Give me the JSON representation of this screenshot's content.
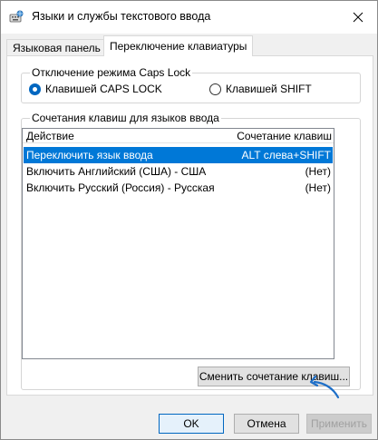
{
  "window": {
    "title": "Языки и службы текстового ввода",
    "icons": {
      "app": "keyboard-globe-icon",
      "close": "close-icon"
    }
  },
  "tabs": [
    {
      "label": "Языковая панель",
      "active": false
    },
    {
      "label": "Переключение клавиатуры",
      "active": true
    }
  ],
  "caps_lock": {
    "legend": "Отключение режима Caps Lock",
    "options": [
      {
        "label": "Клавишей CAPS LOCK",
        "checked": true
      },
      {
        "label": "Клавишей SHIFT",
        "checked": false
      }
    ]
  },
  "hotkeys": {
    "legend": "Сочетания клавиш для языков ввода",
    "columns": {
      "action": "Действие",
      "combo": "Сочетание клавиш"
    },
    "rows": [
      {
        "action": "Переключить язык ввода",
        "combo": "ALT слева+SHIFT",
        "selected": true
      },
      {
        "action": "Включить Английский (США) - США",
        "combo": "(Нет)",
        "selected": false
      },
      {
        "action": "Включить Русский (Россия) - Русская",
        "combo": "(Нет)",
        "selected": false
      }
    ],
    "change_button": "Сменить сочетание клавиш..."
  },
  "footer": {
    "ok": "OK",
    "cancel": "Отмена",
    "apply": "Применить"
  },
  "colors": {
    "accent": "#0078d7",
    "annotation_arrow": "#1e6fc8"
  }
}
